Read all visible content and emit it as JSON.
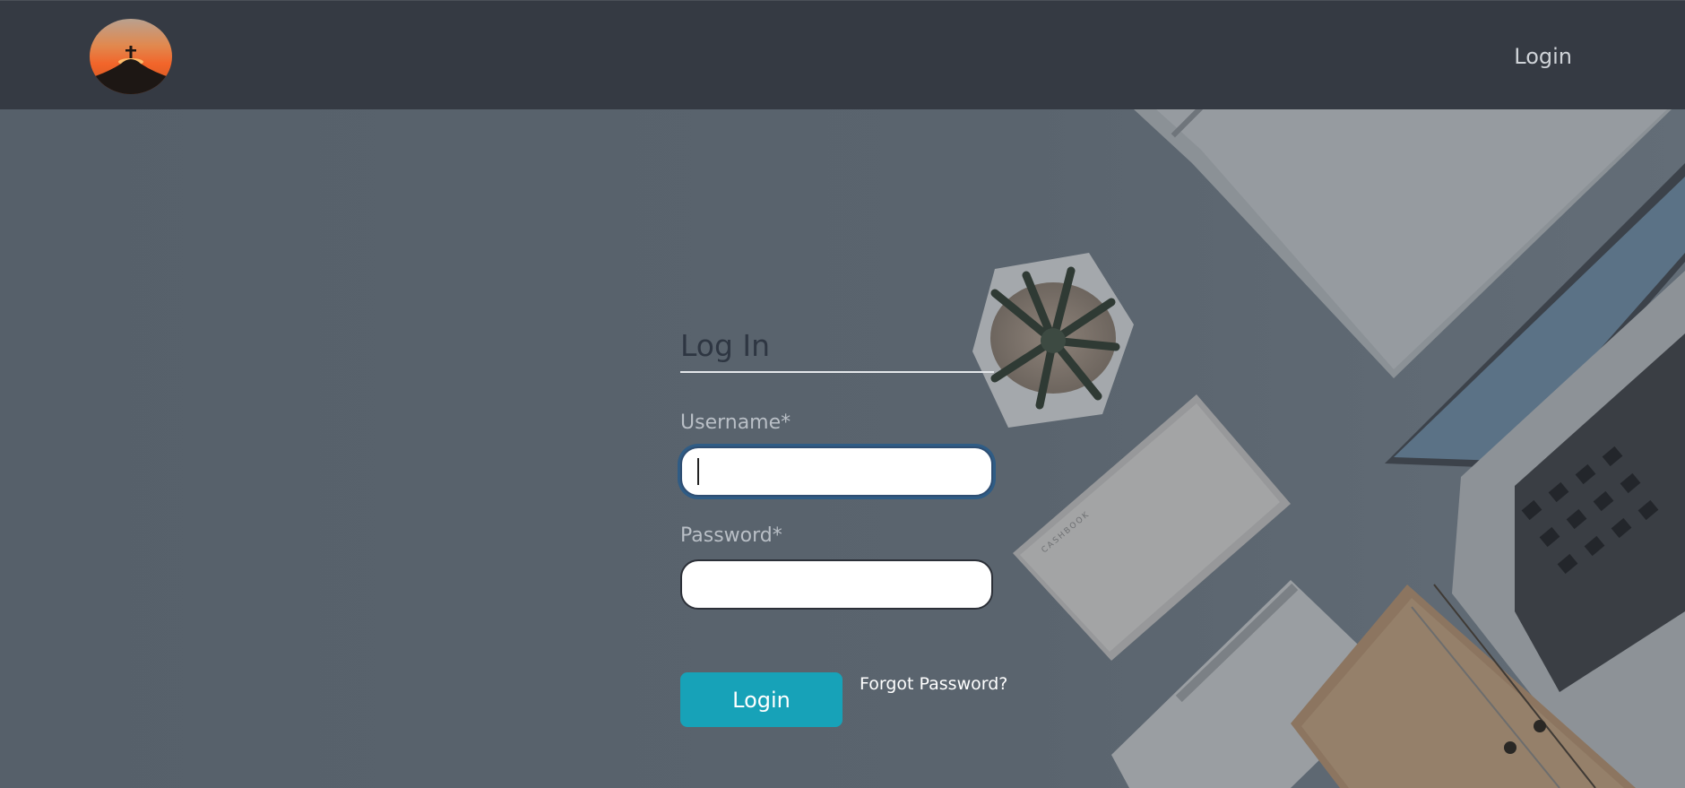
{
  "header": {
    "logo_icon": "hilltop-cross-sunset-icon",
    "nav_login_label": "Login"
  },
  "form": {
    "title": "Log In",
    "username_label": "Username*",
    "username_value": "",
    "password_label": "Password*",
    "password_value": "",
    "submit_label": "Login",
    "forgot_label": "Forgot Password?"
  },
  "colors": {
    "header_bg": "#353a43",
    "page_bg": "#56606a",
    "accent": "#17a2b8",
    "focus_ring": "#2f5c85"
  },
  "background_scene": {
    "items": [
      "desk-plant-icon",
      "cashbook-icon",
      "notepad-icon",
      "laptop-icon",
      "folder-icon",
      "paper-sheet-icon"
    ],
    "cashbook_text": "CASHBOOK"
  }
}
